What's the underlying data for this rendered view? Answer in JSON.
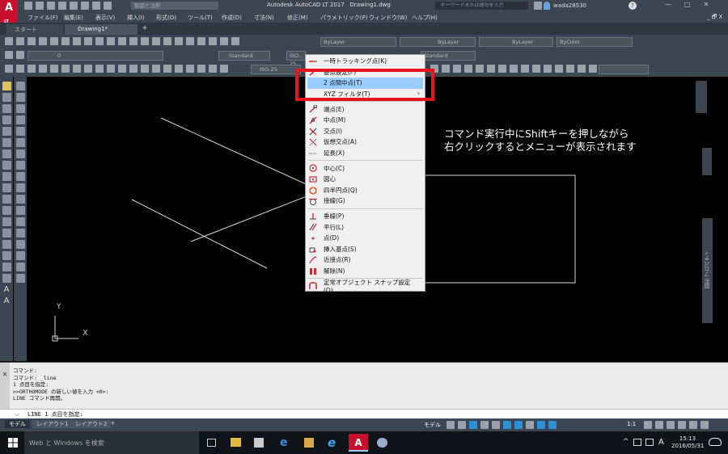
{
  "titlebar": {
    "app_title": "Autodesk AutoCAD LT 2017",
    "file_name": "Drawing1.dwg",
    "workspace": "製図と注釈",
    "search_placeholder": "キーワードまたは語句を入力",
    "user": "wada28530",
    "controls": [
      "—",
      "□",
      "✕"
    ]
  },
  "menubar": {
    "items": [
      "ファイル(F)",
      "編集(E)",
      "表示(V)",
      "挿入(I)",
      "形式(O)",
      "ツール(T)",
      "作成(D)",
      "寸法(N)",
      "修正(M)",
      "パラメトリック(P)",
      "ウィンドウ(W)",
      "ヘルプ(H)"
    ],
    "right": "_ 🗗 X"
  },
  "tabs": {
    "items": [
      "スタート",
      "Drawing1*"
    ],
    "add": "+"
  },
  "properties": {
    "layer": "ByLayer",
    "linetype": "ByLayer",
    "lineweight": "ByLayer",
    "color": "ByColor",
    "layer_name": "0",
    "text_style": "Standard",
    "dim_style": "ISO-25",
    "table_style": "Standard",
    "mleader_style": "ISO-25"
  },
  "context_menu": {
    "groups": [
      [
        {
          "icon": "tracking-icon",
          "label": "一時トラッキング点(K)"
        },
        {
          "icon": "from-icon",
          "label": "基点設定(F)"
        },
        {
          "icon": "midbetween-icon",
          "label": "2 点間中点(T)",
          "highlighted": true
        },
        {
          "icon": "",
          "label": "XYZ フィルタ(T)",
          "submenu": true
        }
      ],
      [
        {
          "icon": "endpoint-icon",
          "label": "端点(E)"
        },
        {
          "icon": "midpoint-icon",
          "label": "中点(M)"
        },
        {
          "icon": "intersection-icon",
          "label": "交点(I)"
        },
        {
          "icon": "apparent-intersection-icon",
          "label": "仮想交点(A)"
        },
        {
          "icon": "extension-icon",
          "label": "延長(X)"
        }
      ],
      [
        {
          "icon": "center-icon",
          "label": "中心(C)"
        },
        {
          "icon": "geometric-center-icon",
          "label": "図心"
        },
        {
          "icon": "quadrant-icon",
          "label": "四半円点(Q)"
        },
        {
          "icon": "tangent-icon",
          "label": "接線(G)"
        }
      ],
      [
        {
          "icon": "perpendicular-icon",
          "label": "垂線(P)"
        },
        {
          "icon": "parallel-icon",
          "label": "平行(L)"
        },
        {
          "icon": "node-icon",
          "label": "点(D)"
        },
        {
          "icon": "insertion-icon",
          "label": "挿入基点(S)"
        },
        {
          "icon": "nearest-icon",
          "label": "近接点(R)"
        },
        {
          "icon": "none-icon",
          "label": "解除(N)"
        }
      ],
      [
        {
          "icon": "osnap-settings-icon",
          "label": "定常オブジェクト スナップ設定(O)..."
        }
      ]
    ]
  },
  "annotation": {
    "line1": "コマンド実行中にShiftキーを押しながら",
    "line2": "右クリックするとメニューが表示されます"
  },
  "ucs": {
    "x": "X",
    "y": "Y"
  },
  "right_palette": {
    "label": "図形 プロパティ"
  },
  "command": {
    "history": [
      "コマンド:",
      "コマンド:  _line",
      "1 点目を指定:",
      ">>ORTHOMODE の新しい値を入力 <0>:",
      "LINE コマンド再開。"
    ],
    "prompt": "LINE 1 点目を指定:"
  },
  "layout_tabs": [
    "モデル",
    "レイアウト1",
    "レイアウト2",
    "+"
  ],
  "statusbar": {
    "model": "モデル",
    "scale": "1:1"
  },
  "taskbar": {
    "search": "Web と Windows を検索",
    "time": "15:13",
    "date": "2016/05/31",
    "ime": "A"
  },
  "colors": {
    "highlight": "#99ccff",
    "red_box": "#e8141c",
    "titlebar_bg": "#3c4652",
    "canvas_bg": "#000000"
  }
}
